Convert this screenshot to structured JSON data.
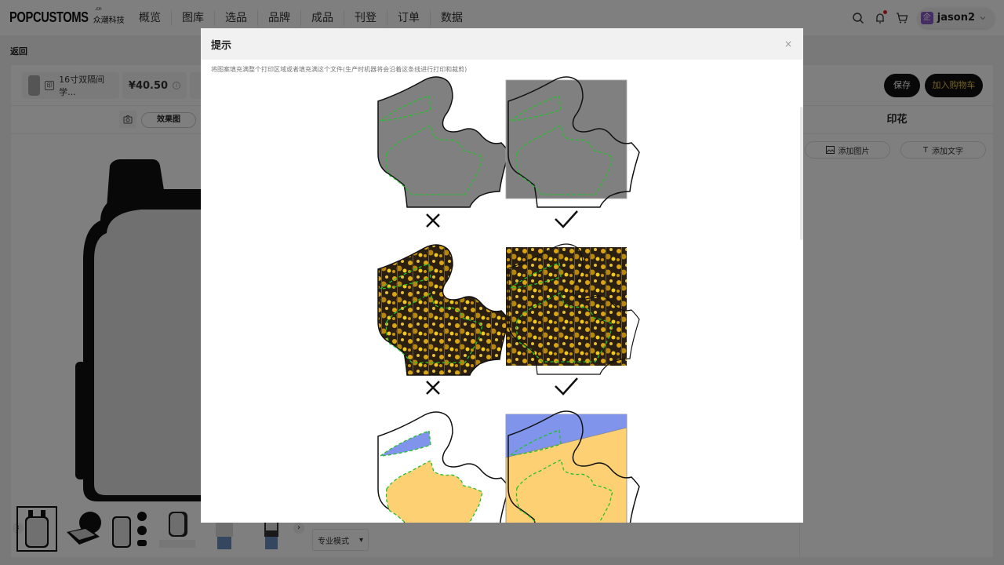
{
  "topnav": {
    "brand": "POPCUSTOMS",
    "brand_sub": "众潮科技",
    "brand_tld": ".cn",
    "items": [
      {
        "label": "概览"
      },
      {
        "label": "图库"
      },
      {
        "label": "选品"
      },
      {
        "label": "品牌"
      },
      {
        "label": "成品"
      },
      {
        "label": "刊登"
      },
      {
        "label": "订单"
      },
      {
        "label": "数据"
      }
    ],
    "icons": [
      "search-icon",
      "bell-icon",
      "cart-icon"
    ],
    "notification_dot": true,
    "user": {
      "name": "jason2",
      "avatar_glyph": "企",
      "avatar_color": "#8b5cc7"
    }
  },
  "backbar": {
    "back_label": "返回"
  },
  "product_bar": {
    "product_name": "16寸双隔间学...",
    "product_icon_glyph": "印",
    "price": "¥40.50",
    "info_glyph": "i",
    "save_label": "保存",
    "add_to_cart_label": "加入购物车",
    "cart_label_color": "#e6c04a"
  },
  "view_bar": {
    "effect_label": "效果图"
  },
  "right_panel": {
    "title": "印花",
    "add_image_label": "添加图片",
    "add_text_label": "添加文字",
    "add_text_glyph": "T"
  },
  "thumbnails": {
    "prev_glyph": "‹",
    "next_glyph": "›",
    "items": [
      {
        "name": "front-view",
        "active": true
      },
      {
        "name": "open-view",
        "active": false
      },
      {
        "name": "detail-view",
        "active": false
      },
      {
        "name": "size-view",
        "active": false
      },
      {
        "name": "model-back-view",
        "active": false
      },
      {
        "name": "model-front-view",
        "active": false
      }
    ]
  },
  "mode_select": {
    "value": "专业模式",
    "caret": "▾"
  },
  "modal": {
    "title": "提示",
    "close_glyph": "×",
    "description": "将图案填充满整个打印区域或者填充满这个文件(生产时机器将会沿着这条线进行打印和裁剪)",
    "examples": [
      {
        "row": 1,
        "fill": "gray",
        "wrong_mark": "✕",
        "right_mark": "✓"
      },
      {
        "row": 2,
        "fill": "autumn-forest-photo",
        "wrong_mark": "✕",
        "right_mark": "✓"
      },
      {
        "row": 3,
        "fill": "blue-and-yellow-blocks",
        "wrong_mark": "",
        "right_mark": ""
      }
    ],
    "colors": {
      "gray_fill": "#808080",
      "dashed_line": "#22c02a",
      "outline": "#111111",
      "blue_fill": "#8094ec",
      "yellow_fill": "#fdd173",
      "forest_dark": "#2a1f10",
      "forest_gold": "#d9a516"
    }
  }
}
